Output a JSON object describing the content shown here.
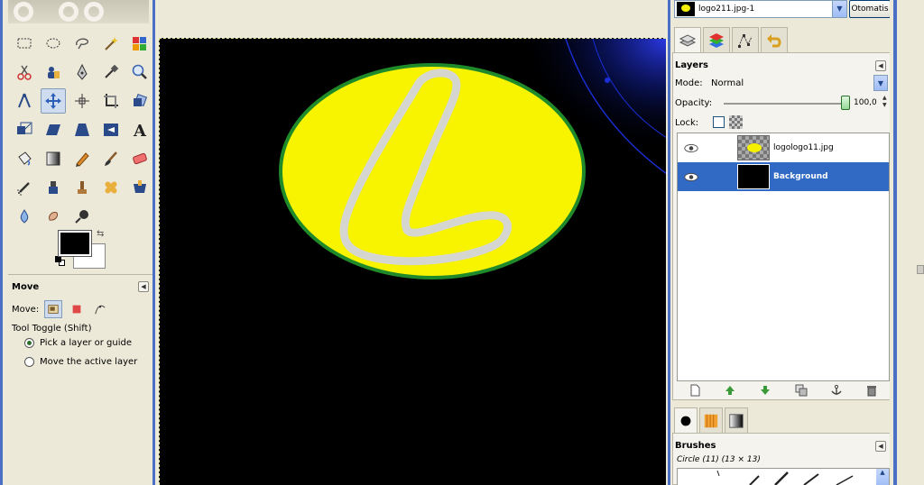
{
  "toolbox": {
    "tools": [
      "rect-select-icon",
      "ellipse-select-icon",
      "free-select-icon",
      "fuzzy-select-icon",
      "select-by-color-icon",
      "scissors-icon",
      "foreground-select-icon",
      "paths-icon",
      "color-picker-icon",
      "zoom-icon",
      "measure-icon",
      "move-icon",
      "align-icon",
      "crop-icon",
      "rotate-icon",
      "scale-icon",
      "shear-icon",
      "perspective-icon",
      "flip-icon",
      "text-icon",
      "bucket-fill-icon",
      "blend-icon",
      "pencil-icon",
      "paintbrush-icon",
      "eraser-icon",
      "airbrush-icon",
      "ink-icon",
      "clone-icon",
      "heal-icon",
      "perspective-clone-icon",
      "blur-icon",
      "smudge-icon",
      "dodge-burn-icon"
    ],
    "active_tool": "move-icon",
    "foreground_color": "#000000",
    "background_color": "#ffffff"
  },
  "tool_options": {
    "title": "Move",
    "move_label": "Move:",
    "toggle_label": "Tool Toggle  (Shift)",
    "options": [
      {
        "label": "Pick a layer or guide",
        "selected": true
      },
      {
        "label": "Move the active layer",
        "selected": false
      }
    ]
  },
  "canvas": {
    "background": "#000000",
    "ellipse_fill": "#f8f400",
    "ellipse_border": "#1f8a2a",
    "letter_color": "#d6d6d0",
    "ray_color": "#1a2fd8"
  },
  "dock": {
    "image_menu": {
      "label": "logo211.jpg-1"
    },
    "auto_button": "Otomatis",
    "layers": {
      "title": "Layers",
      "mode_label": "Mode:",
      "mode_value": "Normal",
      "opacity_label": "Opacity:",
      "opacity_value": "100,0",
      "lock_label": "Lock:",
      "items": [
        {
          "name": "logologo11.jpg",
          "visible": true,
          "selected": false
        },
        {
          "name": "Background",
          "visible": true,
          "selected": true
        }
      ]
    },
    "brushes": {
      "title": "Brushes",
      "selected_name": "Circle (11) (13 × 13)"
    }
  }
}
